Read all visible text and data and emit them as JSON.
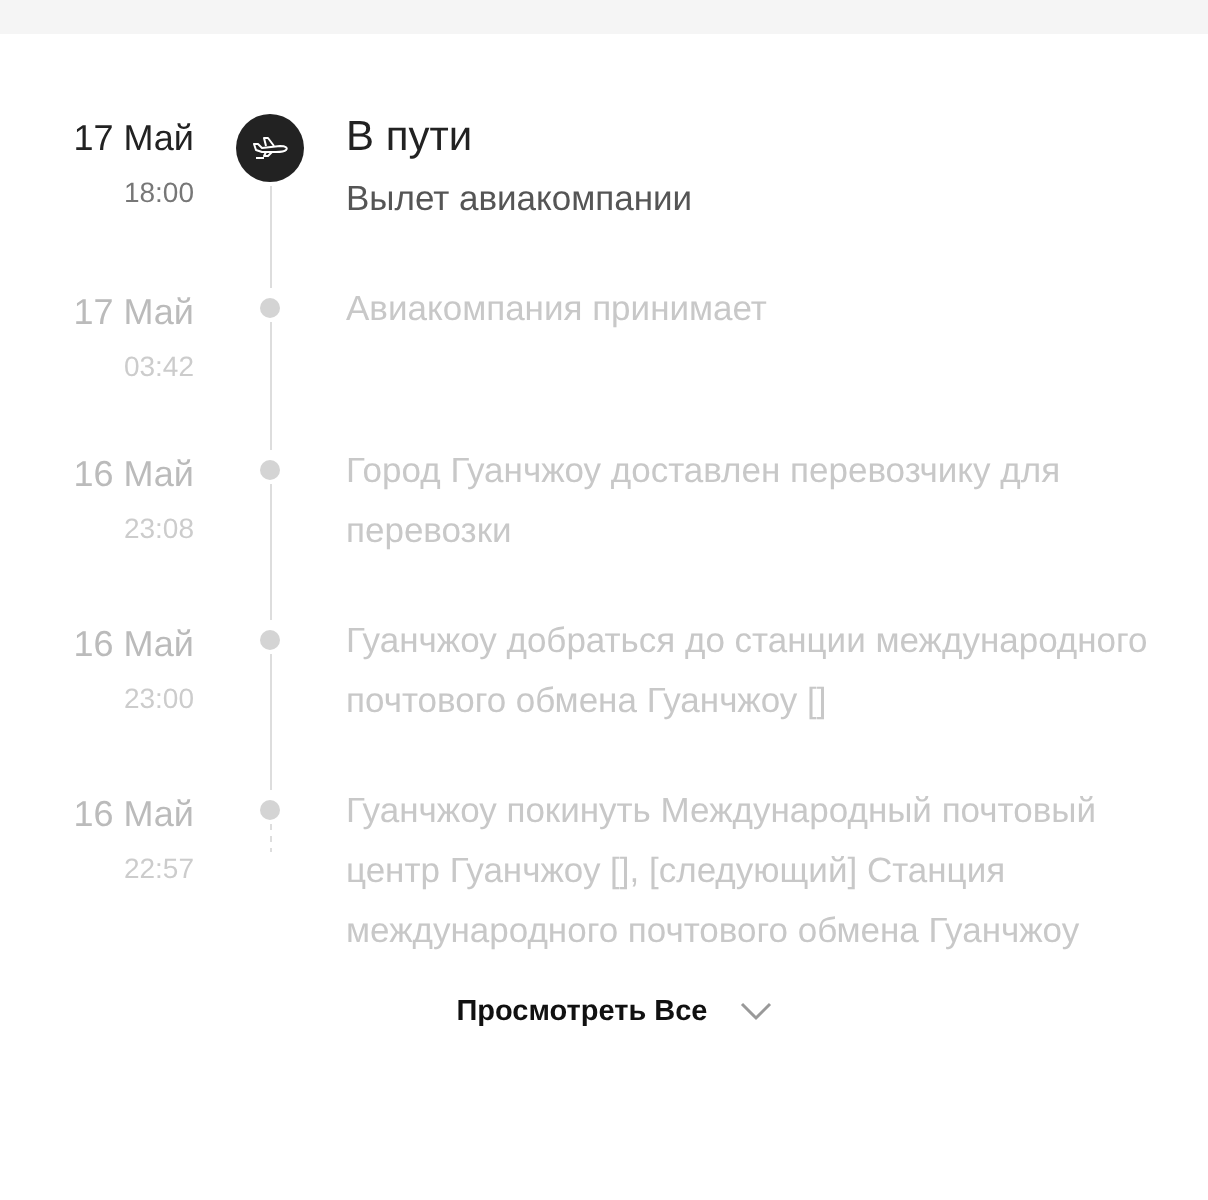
{
  "events": [
    {
      "date": "17 Май",
      "time": "18:00",
      "title": "В пути",
      "description": "Вылет авиакомпании",
      "current": true
    },
    {
      "date": "17 Май",
      "time": "03:42",
      "description": "Авиакомпания принимает",
      "current": false
    },
    {
      "date": "16 Май",
      "time": "23:08",
      "description": "Город Гуанчжоу доставлен перевозчику для перевозки",
      "current": false
    },
    {
      "date": "16 Май",
      "time": "23:00",
      "description": "Гуанчжоу добраться до станции международного почтового обмена Гуанчжоу []",
      "current": false
    },
    {
      "date": "16 Май",
      "time": "22:57",
      "description": "Гуанчжоу покинуть Международный почтовый центр Гуанчжоу [], [следующий] Станция международного почтового обмена Гуанчжоу",
      "current": false
    }
  ],
  "view_all": {
    "label": "Просмотреть Все"
  }
}
